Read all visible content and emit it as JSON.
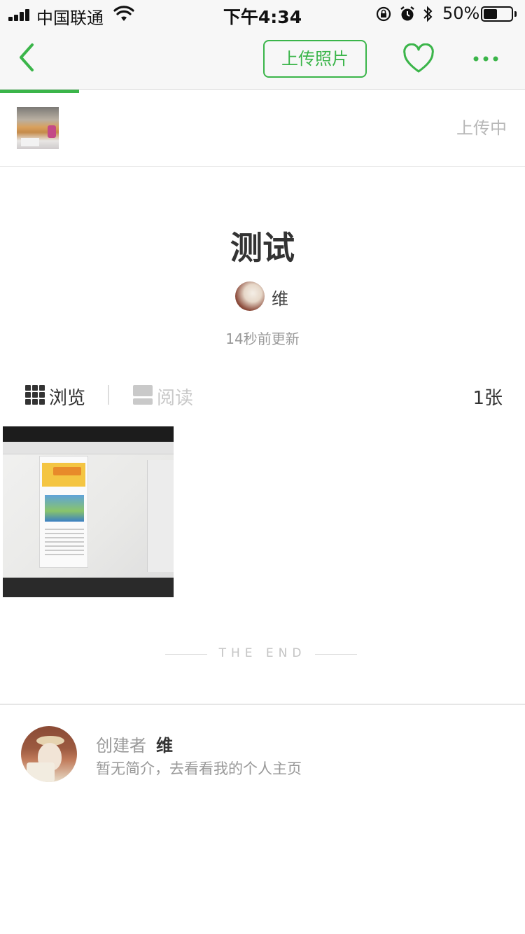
{
  "status_bar": {
    "carrier": "中国联通",
    "time": "下午4:34",
    "battery_percent": "50%",
    "battery_level": 0.5
  },
  "nav": {
    "upload_photo_label": "上传照片",
    "upload_progress": 0.15,
    "accent_color": "#3bb54a"
  },
  "upload_queue": {
    "status": "上传中"
  },
  "album": {
    "title": "测试",
    "owner_name": "维",
    "updated": "14秒前更新"
  },
  "mode_tabs": {
    "browse_label": "浏览",
    "read_label": "阅读",
    "count": "1张",
    "active": "browse"
  },
  "end_marker": "THE END",
  "creator": {
    "label": "创建者",
    "name": "维",
    "bio": "暂无简介，去看看我的个人主页"
  }
}
